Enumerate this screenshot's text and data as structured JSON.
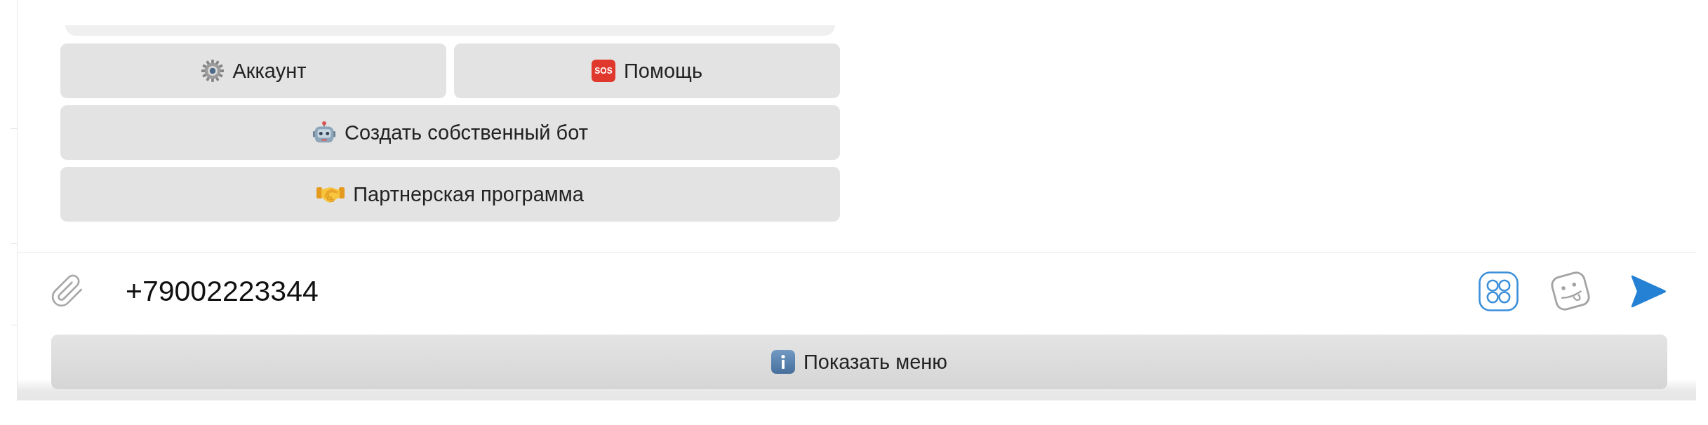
{
  "keyboard": {
    "rows": [
      [
        {
          "label": "Аккаунт"
        },
        {
          "label": "Помощь",
          "badge": "SOS"
        }
      ],
      [
        {
          "label": "Создать собственный бот"
        }
      ],
      [
        {
          "label": "Партнерская программа"
        }
      ]
    ]
  },
  "composer": {
    "value": "+79002223344"
  },
  "menu_button": {
    "label": "Показать меню"
  }
}
